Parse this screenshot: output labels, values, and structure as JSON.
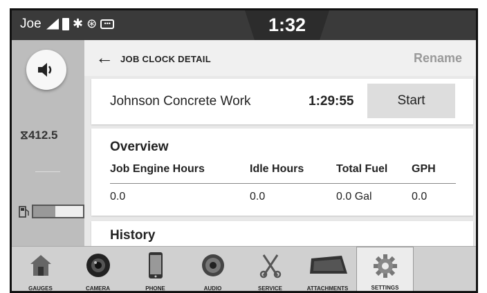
{
  "status": {
    "user": "Joe",
    "time": "1:32",
    "dots": "•••"
  },
  "rail": {
    "hours_icon": "⧖",
    "engine_hours": "412.5",
    "fuel_level": 0.45
  },
  "header": {
    "back_icon": "←",
    "title": "JOB CLOCK DETAIL",
    "rename": "Rename"
  },
  "job": {
    "name": "Johnson Concrete Work",
    "time": "1:29:55",
    "start": "Start"
  },
  "overview": {
    "title": "Overview",
    "headers": [
      "Job Engine Hours",
      "Idle Hours",
      "Total Fuel",
      "GPH"
    ],
    "values": [
      "0.0",
      "0.0",
      "0.0 Gal",
      "0.0"
    ]
  },
  "history": {
    "title": "History"
  },
  "nav": {
    "items": [
      {
        "label": "GAUGES",
        "icon": "house-icon"
      },
      {
        "label": "CAMERA",
        "icon": "camera-icon"
      },
      {
        "label": "PHONE",
        "icon": "phone-icon"
      },
      {
        "label": "AUDIO",
        "icon": "speaker-icon"
      },
      {
        "label": "SERVICE",
        "icon": "wrench-icon"
      },
      {
        "label": "ATTACHMENTS",
        "icon": "bucket-icon"
      },
      {
        "label": "SETTINGS",
        "icon": "gear-icon"
      }
    ],
    "active": "SETTINGS"
  }
}
